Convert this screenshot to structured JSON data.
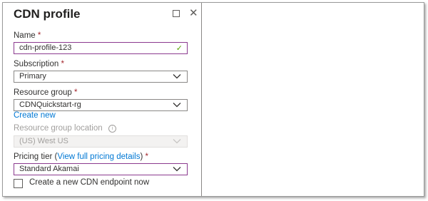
{
  "panel": {
    "title": "CDN profile"
  },
  "form": {
    "name": {
      "label": "Name",
      "required": "*",
      "value": "cdn-profile-123"
    },
    "subscription": {
      "label": "Subscription",
      "required": "*",
      "value": "Primary"
    },
    "resource_group": {
      "label": "Resource group",
      "required": "*",
      "value": "CDNQuickstart-rg",
      "create_new": "Create new"
    },
    "resource_group_location": {
      "label": "Resource group location",
      "value": "(US) West US"
    },
    "pricing_tier": {
      "label_prefix": "Pricing tier (",
      "link": "View full pricing details",
      "label_suffix": ")",
      "required": "*",
      "value": "Standard Akamai"
    },
    "create_endpoint": {
      "label": "Create a new CDN endpoint now",
      "checked": false
    }
  },
  "icons": {
    "maximize": "maximize-icon",
    "close": "close-icon",
    "dropdown": "chevron-down-icon",
    "valid": "checkmark-icon",
    "info": "info-icon"
  },
  "colors": {
    "accent_link": "#0078d4",
    "required": "#a4262c",
    "active_border": "#8b3a8f",
    "valid": "#57a300"
  }
}
